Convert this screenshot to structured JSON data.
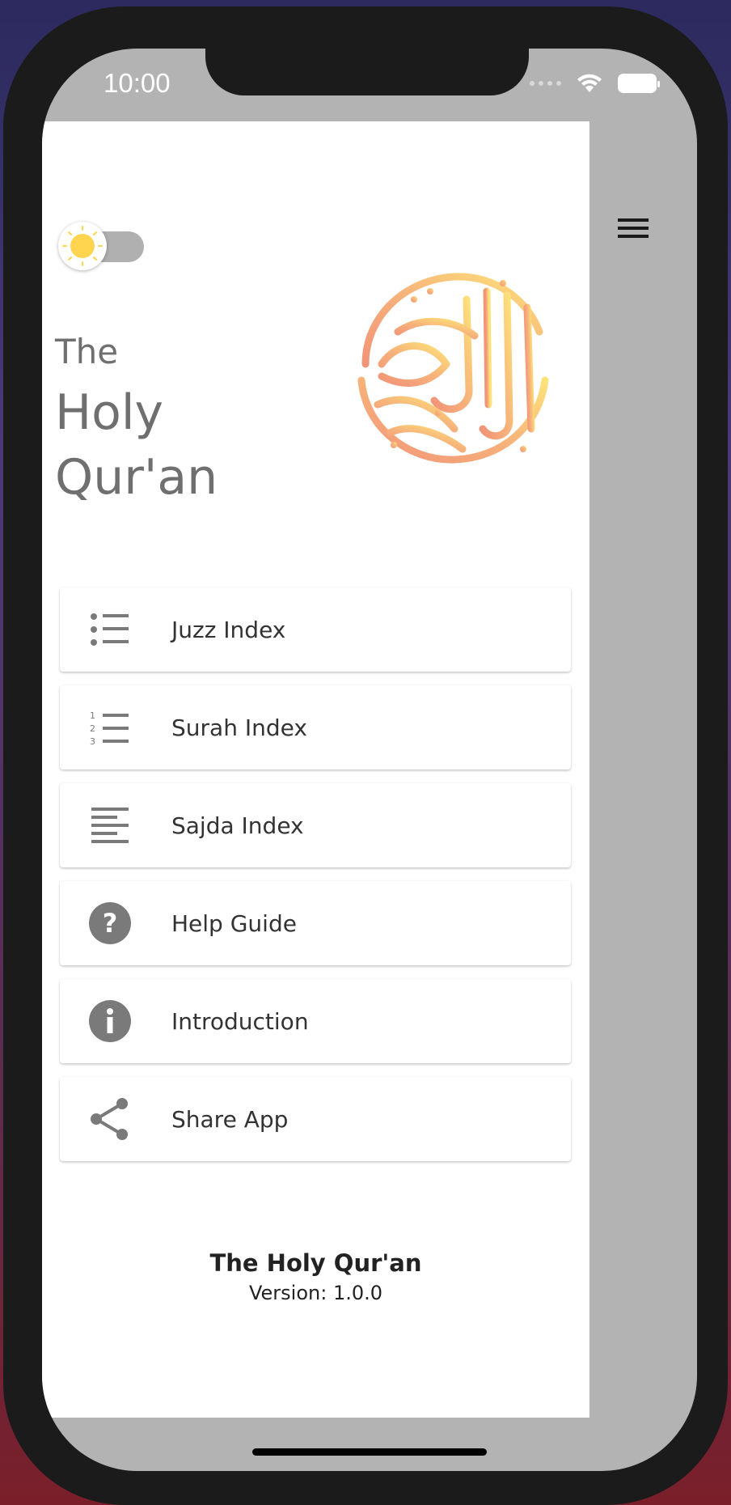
{
  "status_bar": {
    "time": "10:00"
  },
  "header": {
    "title_line1": "The",
    "title_line2": "Holy",
    "title_line3": "Qur'an"
  },
  "theme_toggle": {
    "state": "light",
    "icon": "sun-icon"
  },
  "menu": {
    "items": [
      {
        "label": "Juzz Index",
        "icon": "list-bullet-icon"
      },
      {
        "label": "Surah Index",
        "icon": "numbered-list-icon"
      },
      {
        "label": "Sajda Index",
        "icon": "align-left-icon"
      },
      {
        "label": "Help Guide",
        "icon": "help-circle-icon"
      },
      {
        "label": "Introduction",
        "icon": "info-circle-icon"
      },
      {
        "label": "Share App",
        "icon": "share-icon"
      }
    ]
  },
  "footer": {
    "title": "The Holy Qur'an",
    "version": "Version: 1.0.0"
  },
  "colors": {
    "drawer_bg": "#ffffff",
    "scrim": "#b3b3b3",
    "icon": "#7a7a7a",
    "title_text": "#6f6f6f",
    "sun": "#ffd54f",
    "logo_gradient": [
      "#f29478",
      "#f7b27a",
      "#fde27a"
    ]
  }
}
